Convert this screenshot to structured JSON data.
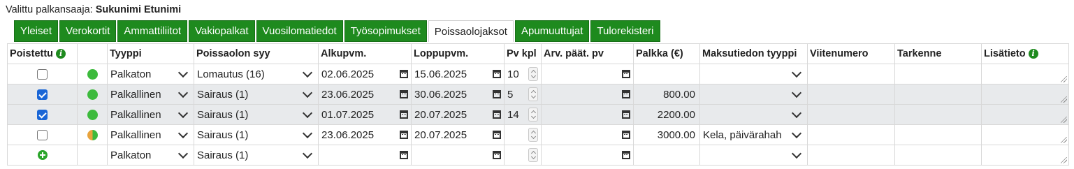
{
  "header": {
    "label": "Valittu palkansaaja:",
    "name": "Sukunimi Etunimi"
  },
  "tabs": [
    {
      "label": "Yleiset",
      "active": false
    },
    {
      "label": "Verokortit",
      "active": false
    },
    {
      "label": "Ammattiliitot",
      "active": false
    },
    {
      "label": "Vakiopalkat",
      "active": false
    },
    {
      "label": "Vuosilomatiedot",
      "active": false
    },
    {
      "label": "Työsopimukset",
      "active": false
    },
    {
      "label": "Poissaolojaksot",
      "active": true
    },
    {
      "label": "Apumuuttujat",
      "active": false
    },
    {
      "label": "Tulorekisteri",
      "active": false
    }
  ],
  "columns": {
    "deleted": "Poistettu",
    "type": "Tyyppi",
    "reason": "Poissaolon syy",
    "start": "Alkupvm.",
    "end": "Loppupvm.",
    "days": "Pv kpl",
    "est_decision": "Arv. päät. pv",
    "salary": "Palkka (€)",
    "payment_type": "Maksutiedon tyyppi",
    "reference": "Viitenumero",
    "spec": "Tarkenne",
    "extra": "Lisätieto"
  },
  "rows": [
    {
      "deleted": false,
      "status": "green",
      "type": "Palkaton",
      "reason": "Lomautus (16)",
      "start": "02.06.2025",
      "end": "15.06.2025",
      "days": "10",
      "est_decision": "",
      "salary": "",
      "payment_type": "",
      "shade": false
    },
    {
      "deleted": true,
      "status": "green",
      "type": "Palkallinen",
      "reason": "Sairaus (1)",
      "start": "23.06.2025",
      "end": "30.06.2025",
      "days": "5",
      "est_decision": "",
      "salary": "800.00",
      "payment_type": "",
      "shade": true
    },
    {
      "deleted": true,
      "status": "green",
      "type": "Palkallinen",
      "reason": "Sairaus (1)",
      "start": "01.07.2025",
      "end": "20.07.2025",
      "days": "14",
      "est_decision": "",
      "salary": "2200.00",
      "payment_type": "",
      "shade": true
    },
    {
      "deleted": false,
      "status": "half",
      "type": "Palkallinen",
      "reason": "Sairaus (1)",
      "start": "23.06.2025",
      "end": "20.07.2025",
      "days": "",
      "est_decision": "",
      "salary": "3000.00",
      "payment_type": "Kela, päivärahah",
      "shade": false
    }
  ],
  "new_row": {
    "type": "Palkaton",
    "reason": "Sairaus (1)"
  },
  "colors": {
    "tab_green": "#1e8a1e",
    "shade": "#e8eaec",
    "checkbox_blue": "#1a66d6",
    "status_green": "#3dba3d",
    "status_orange": "#e8a33c"
  }
}
